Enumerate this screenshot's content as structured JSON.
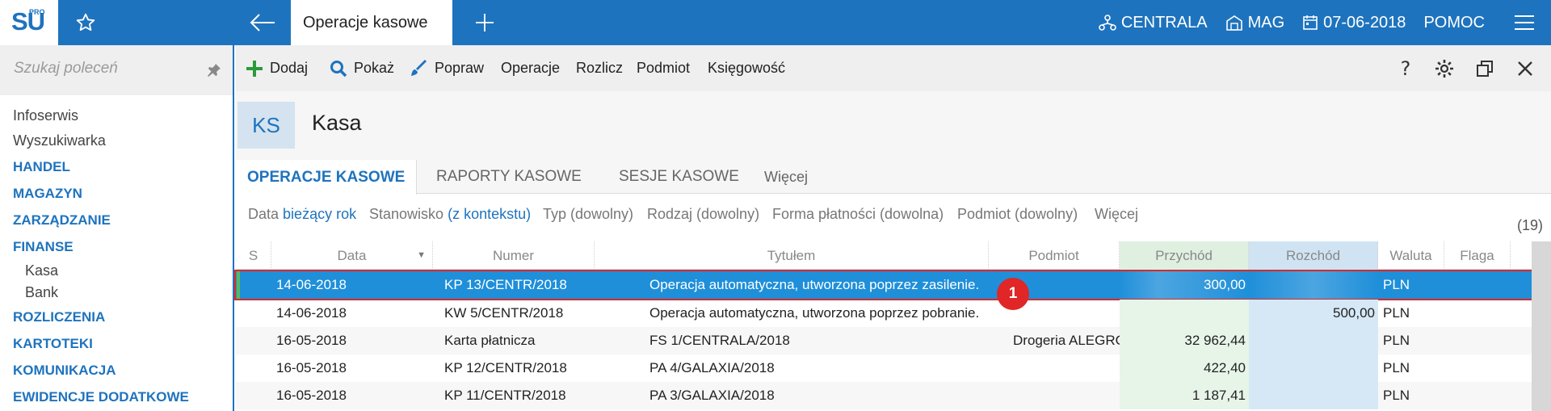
{
  "app": {
    "logo_text": "SU",
    "logo_sup": "PRO",
    "active_tab": "Operacje kasowe"
  },
  "topbar_right": {
    "company": "CENTRALA",
    "warehouse": "MAG",
    "date": "07-06-2018",
    "help": "POMOC"
  },
  "sidebar": {
    "search_placeholder": "Szukaj poleceń",
    "items": [
      {
        "label": "Infoserwis",
        "kind": "item"
      },
      {
        "label": "Wyszukiwarka",
        "kind": "item"
      },
      {
        "label": "HANDEL",
        "kind": "cat"
      },
      {
        "label": "MAGAZYN",
        "kind": "cat"
      },
      {
        "label": "ZARZĄDZANIE",
        "kind": "cat"
      },
      {
        "label": "FINANSE",
        "kind": "cat"
      },
      {
        "label": "Kasa",
        "kind": "sub"
      },
      {
        "label": "Bank",
        "kind": "sub"
      },
      {
        "label": "ROZLICZENIA",
        "kind": "cat"
      },
      {
        "label": "KARTOTEKI",
        "kind": "cat"
      },
      {
        "label": "KOMUNIKACJA",
        "kind": "cat"
      },
      {
        "label": "EWIDENCJE DODATKOWE",
        "kind": "cat"
      }
    ]
  },
  "toolbar": {
    "add": "Dodaj",
    "show": "Pokaż",
    "edit": "Popraw",
    "operations": "Operacje",
    "settle": "Rozlicz",
    "entity": "Podmiot",
    "accounting": "Księgowość"
  },
  "header": {
    "badge": "KS",
    "title": "Kasa"
  },
  "tabs": {
    "t1": "OPERACJE KASOWE",
    "t2": "RAPORTY KASOWE",
    "t3": "SESJE KASOWE",
    "more": "Więcej"
  },
  "filters": {
    "date_label": "Data",
    "date_value": "bieżący rok",
    "station_label": "Stanowisko",
    "station_value": "(z kontekstu)",
    "type": "Typ (dowolny)",
    "kind": "Rodzaj (dowolny)",
    "payment": "Forma płatności (dowolna)",
    "entity": "Podmiot (dowolny)",
    "more": "Więcej",
    "count": "(19)"
  },
  "grid": {
    "columns": {
      "s": "S",
      "date": "Data",
      "number": "Numer",
      "title": "Tytułem",
      "entity": "Podmiot",
      "income": "Przychód",
      "expense": "Rozchód",
      "currency": "Waluta",
      "flag": "Flaga"
    },
    "rows": [
      {
        "date": "14-06-2018",
        "number": "KP 13/CENTR/2018",
        "title": "Operacja automatyczna, utworzona poprzez zasilenie.",
        "entity": "",
        "income": "300,00",
        "expense": "",
        "currency": "PLN"
      },
      {
        "date": "14-06-2018",
        "number": "KW 5/CENTR/2018",
        "title": "Operacja automatyczna, utworzona poprzez pobranie.",
        "entity": "",
        "income": "",
        "expense": "500,00",
        "currency": "PLN"
      },
      {
        "date": "16-05-2018",
        "number": "Karta płatnicza",
        "title": "FS 1/CENTRALA/2018",
        "entity": "Drogeria ALEGRO",
        "income": "32 962,44",
        "expense": "",
        "currency": "PLN"
      },
      {
        "date": "16-05-2018",
        "number": "KP 12/CENTR/2018",
        "title": "PA 4/GALAXIA/2018",
        "entity": "",
        "income": "422,40",
        "expense": "",
        "currency": "PLN"
      },
      {
        "date": "16-05-2018",
        "number": "KP 11/CENTR/2018",
        "title": "PA 3/GALAXIA/2018",
        "entity": "",
        "income": "1 187,41",
        "expense": "",
        "currency": "PLN"
      }
    ],
    "marker": "1"
  }
}
